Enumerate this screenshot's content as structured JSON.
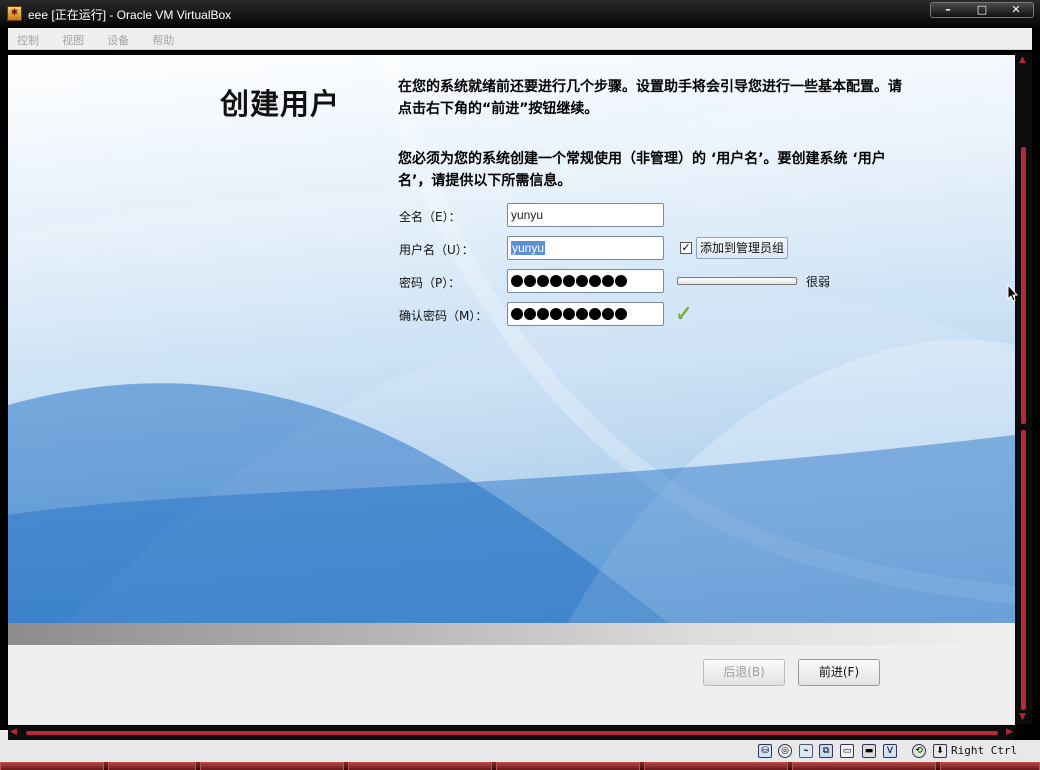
{
  "window": {
    "title": "eee [正在运行] - Oracle VM VirtualBox",
    "controls": [
      "–",
      "□",
      "✕"
    ]
  },
  "menu": {
    "items": [
      "控制",
      "视图",
      "设备",
      "帮助"
    ]
  },
  "setup": {
    "heading": "创建用户",
    "intro": "在您的系统就绪前还要进行几个步骤。设置助手将会引导您进行一些基本配置。请点击右下角的“前进”按钮继续。",
    "notice": "您必须为您的系统创建一个常规使用（非管理）的 ‘用户名’。要创建系统 ‘用户名’，请提供以下所需信息。",
    "fields": {
      "fullname": {
        "label": "全名（E）：",
        "value": "yunyu"
      },
      "username": {
        "label": "用户名（U）：",
        "value": "yunyu"
      },
      "password": {
        "label": "密码（P）：",
        "masked_length": 9
      },
      "confirm": {
        "label": "确认密码（M）：",
        "masked_length": 9
      }
    },
    "admin_checkbox": {
      "label": "添加到管理员组",
      "checked": true,
      "mark": "✓"
    },
    "strength": {
      "label": "很弱",
      "level": 0.0
    },
    "match_mark": "✓",
    "buttons": {
      "back": "后退(B)",
      "forward": "前进(F)"
    }
  },
  "statusbar": {
    "icons": [
      "harddisk-icon",
      "optical-drive-icon",
      "usb-icon",
      "network-icon",
      "shared-folder-icon",
      "display-icon",
      "virtualization-icon",
      "mouse-integration-icon",
      "keyboard-capture-icon"
    ],
    "host_key": "Right Ctrl"
  },
  "colors": {
    "title_bar": "#050505",
    "scrollbar_accent": "#b8283a",
    "check_green": "#7fc33a",
    "selection": "#5b8fd6"
  }
}
